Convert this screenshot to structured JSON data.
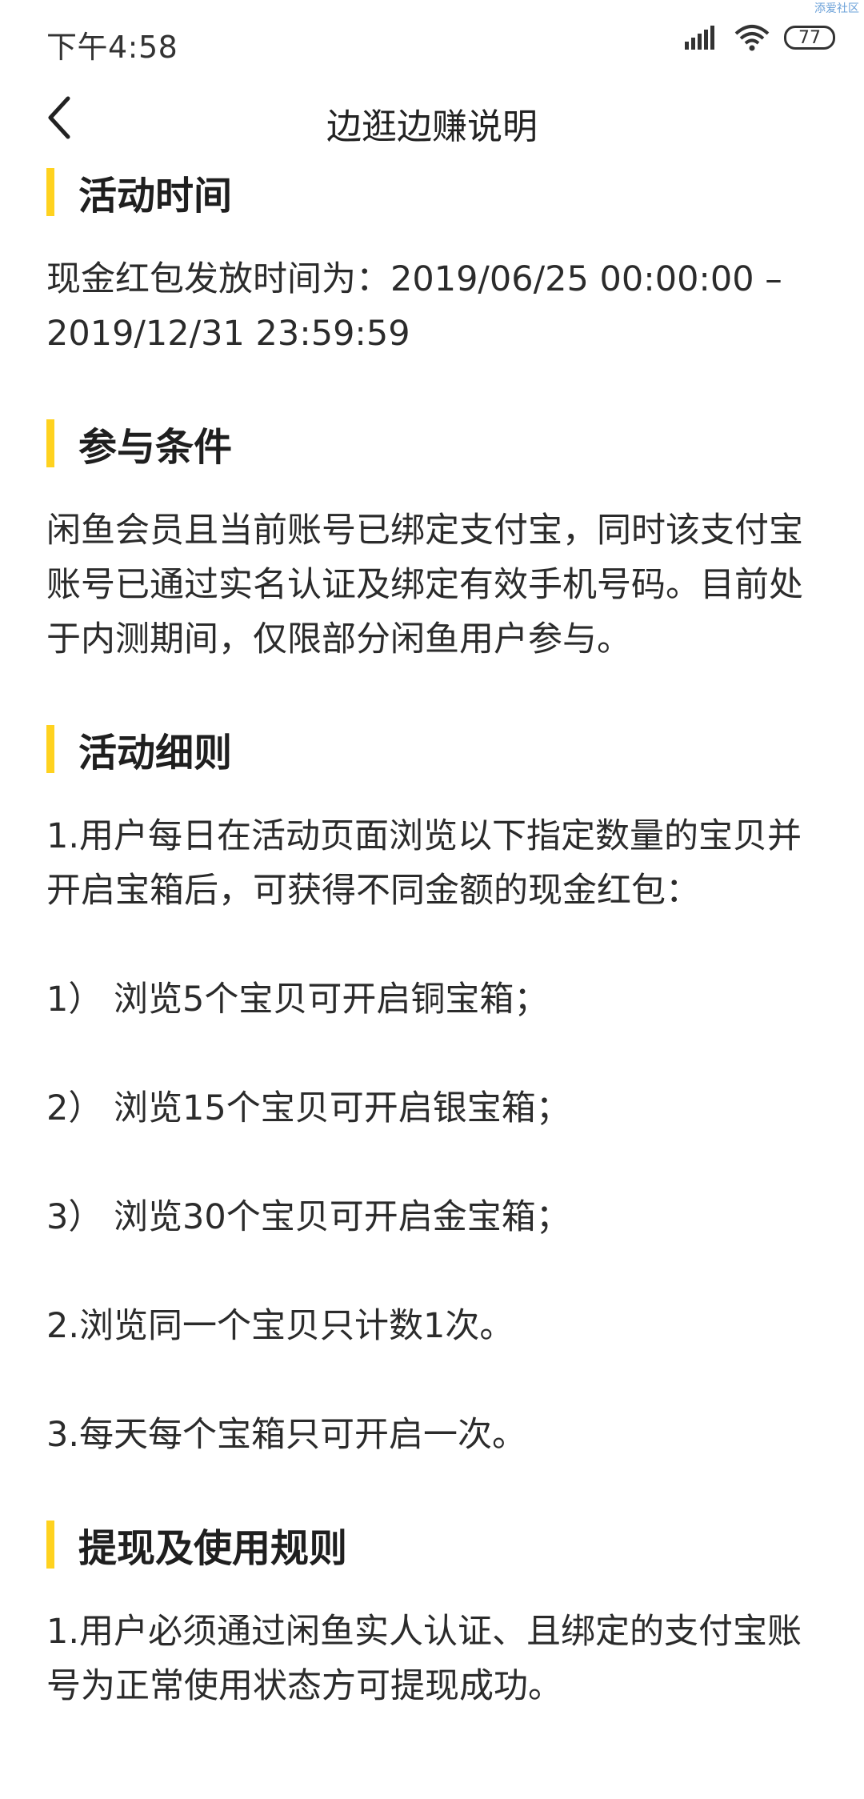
{
  "status_bar": {
    "time": "下午4:58",
    "battery": "77",
    "watermark": "添爱社区"
  },
  "nav": {
    "title": "边逛边赚说明"
  },
  "sections": [
    {
      "title": "活动时间",
      "paragraphs": [
        "现金红包发放时间为：2019/06/25 00:00:00 – 2019/12/31 23:59:59"
      ]
    },
    {
      "title": "参与条件",
      "paragraphs": [
        "闲鱼会员且当前账号已绑定支付宝，同时该支付宝账号已通过实名认证及绑定有效手机号码。目前处于内测期间，仅限部分闲鱼用户参与。"
      ]
    },
    {
      "title": "活动细则",
      "paragraphs": [
        "1.用户每日在活动页面浏览以下指定数量的宝贝并开启宝箱后，可获得不同金额的现金红包：",
        "1） 浏览5个宝贝可开启铜宝箱；",
        "2） 浏览15个宝贝可开启银宝箱；",
        "3） 浏览30个宝贝可开启金宝箱；",
        "2.浏览同一个宝贝只计数1次。",
        "3.每天每个宝箱只可开启一次。"
      ]
    },
    {
      "title": "提现及使用规则",
      "paragraphs": [
        "1.用户必须通过闲鱼实人认证、且绑定的支付宝账号为正常使用状态方可提现成功。"
      ]
    }
  ],
  "colors": {
    "accent": "#ffd21f",
    "text": "#2b2b2b"
  }
}
